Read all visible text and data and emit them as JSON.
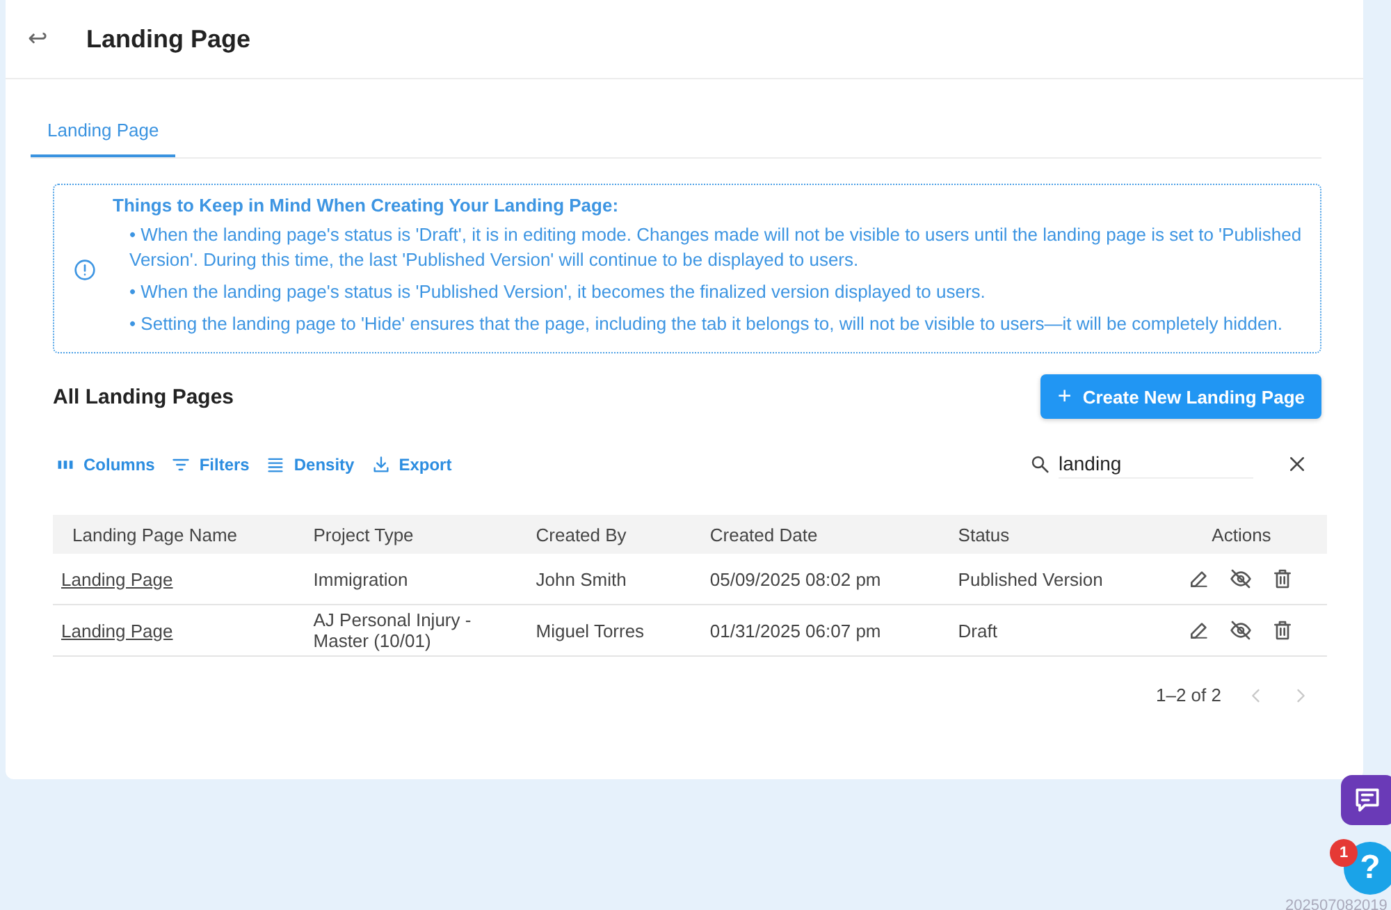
{
  "header": {
    "back_icon": "↩",
    "title": "Landing Page"
  },
  "tabs": [
    {
      "label": "Landing Page",
      "selected": true
    }
  ],
  "notice": {
    "title": "Things to Keep in Mind When Creating Your Landing Page:",
    "items": [
      "• When the landing page's status is 'Draft', it is in editing mode. Changes made will not be visible to users until the landing page is set to 'Published Version'. During this time, the last 'Published Version' will continue to be displayed to users.",
      "• When the landing page's status is 'Published Version', it becomes the finalized version displayed to users.",
      "• Setting the landing page to 'Hide' ensures that the page, including the tab it belongs to, will not be visible to users—it will be completely hidden."
    ]
  },
  "section_title": "All Landing Pages",
  "create_button": {
    "icon": "+",
    "label": "Create New Landing Page"
  },
  "toolbar": [
    {
      "kind": "columns",
      "label": "Columns"
    },
    {
      "kind": "filters",
      "label": "Filters"
    },
    {
      "kind": "density",
      "label": "Density"
    },
    {
      "kind": "export",
      "label": "Export"
    }
  ],
  "search": {
    "value": "landing"
  },
  "table": {
    "columns": [
      "Landing Page Name",
      "Project Type",
      "Created By",
      "Created Date",
      "Status",
      "Actions"
    ],
    "rows": [
      {
        "name": "Landing Page",
        "project_type": "Immigration",
        "created_by": "John Smith",
        "created_date": "05/09/2025 08:02 pm",
        "status": "Published Version"
      },
      {
        "name": "Landing Page",
        "project_type": "AJ Personal Injury - Master (10/01)",
        "created_by": "Miguel Torres",
        "created_date": "01/31/2025 06:07 pm",
        "status": "Draft"
      }
    ]
  },
  "pagination": {
    "range": "1–2 of 2",
    "prev_disabled": true,
    "next_disabled": true
  },
  "help": {
    "badge": "1",
    "icon": "?"
  },
  "version": "202507082019"
}
